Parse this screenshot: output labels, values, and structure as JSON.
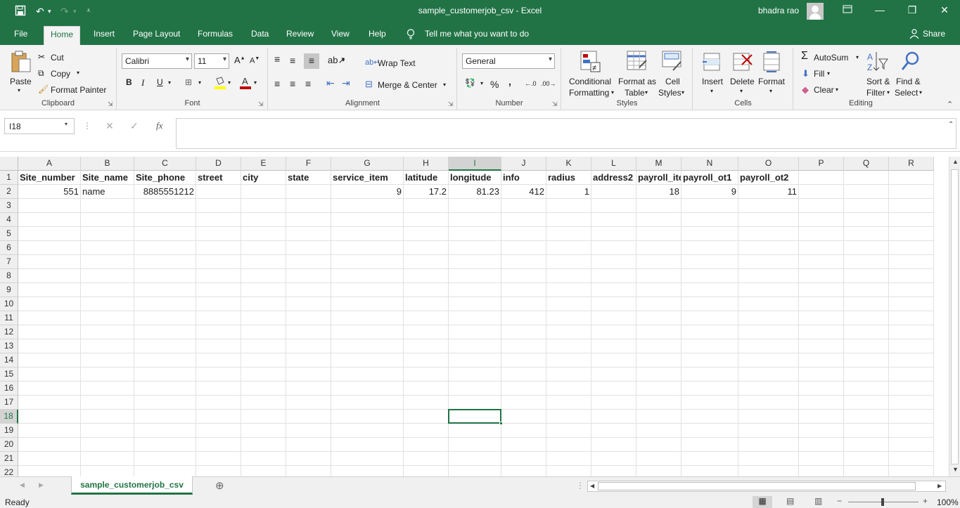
{
  "window": {
    "title": "sample_customerjob_csv  -  Excel",
    "user": "bhadra rao"
  },
  "tabs": [
    "File",
    "Home",
    "Insert",
    "Page Layout",
    "Formulas",
    "Data",
    "Review",
    "View",
    "Help"
  ],
  "tell_me": "Tell me what you want to do",
  "share": "Share",
  "clipboard": {
    "paste": "Paste",
    "cut": "Cut",
    "copy": "Copy",
    "format_painter": "Format Painter",
    "label": "Clipboard"
  },
  "font": {
    "name": "Calibri",
    "size": "11",
    "bold": "B",
    "italic": "I",
    "underline": "U",
    "label": "Font"
  },
  "alignment": {
    "wrap": "Wrap Text",
    "merge": "Merge & Center",
    "label": "Alignment"
  },
  "number": {
    "format": "General",
    "percent": "%",
    "comma": ",",
    "label": "Number"
  },
  "styles": {
    "cond1": "Conditional",
    "cond2": "Formatting",
    "fat1": "Format as",
    "fat2": "Table",
    "cell1": "Cell",
    "cell2": "Styles",
    "label": "Styles"
  },
  "cells": {
    "insert": "Insert",
    "delete": "Delete",
    "format": "Format",
    "label": "Cells"
  },
  "editing": {
    "autosum": "AutoSum",
    "fill": "Fill",
    "clear": "Clear",
    "sort1": "Sort &",
    "sort2": "Filter",
    "find1": "Find &",
    "find2": "Select",
    "label": "Editing"
  },
  "formula_bar": {
    "name_box": "I18",
    "fx": "fx",
    "value": ""
  },
  "columns": [
    "A",
    "B",
    "C",
    "D",
    "E",
    "F",
    "G",
    "H",
    "I",
    "J",
    "K",
    "L",
    "M",
    "N",
    "O",
    "P",
    "Q",
    "R"
  ],
  "rows": [
    "1",
    "2",
    "3",
    "4",
    "5",
    "6",
    "7",
    "8",
    "9",
    "10",
    "11",
    "12",
    "13",
    "14",
    "15",
    "16",
    "17",
    "18",
    "19",
    "20",
    "21",
    "22"
  ],
  "header_row": [
    "Site_number",
    "Site_name",
    "Site_phone",
    "street",
    "city",
    "state",
    "service_item",
    "latitude",
    "longitude",
    "info",
    "radius",
    "address2",
    "payroll_ite",
    "payroll_ot1",
    "payroll_ot2"
  ],
  "data_row": [
    "551",
    "name",
    "8885551212",
    "",
    "",
    "",
    "9",
    "17.2",
    "81.23",
    "412",
    "1",
    "",
    "18",
    "9",
    "11"
  ],
  "selected_cell": "I18",
  "sheet": {
    "name": "sample_customerjob_csv"
  },
  "status": {
    "text": "Ready",
    "zoom": "100%"
  },
  "colors": {
    "accent": "#217346"
  }
}
